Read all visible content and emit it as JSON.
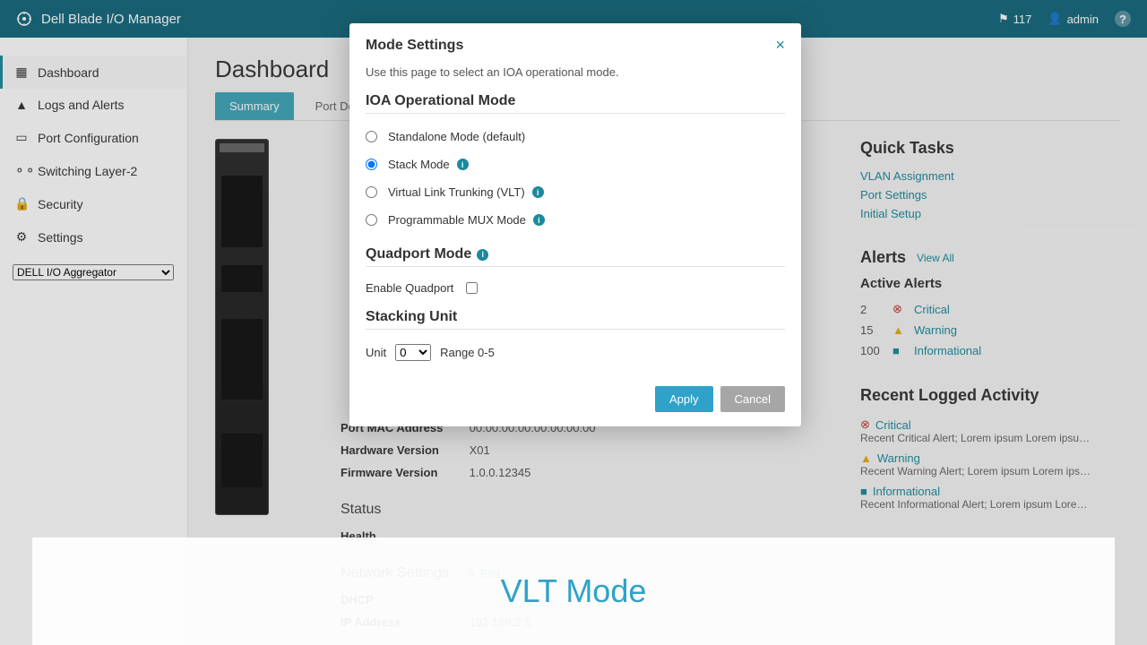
{
  "app": {
    "title": "Dell Blade I/O Manager"
  },
  "header": {
    "flag_count": "117",
    "user": "admin"
  },
  "sidebar": {
    "items": [
      {
        "label": "Dashboard"
      },
      {
        "label": "Logs and Alerts"
      },
      {
        "label": "Port Configuration"
      },
      {
        "label": "Switching Layer-2"
      },
      {
        "label": "Security"
      },
      {
        "label": "Settings"
      }
    ],
    "device_selected": "DELL I/O Aggregator"
  },
  "page": {
    "title": "Dashboard",
    "tabs": [
      {
        "label": "Summary"
      },
      {
        "label": "Port Details"
      }
    ]
  },
  "info": {
    "port_mac_label": "Port MAC Address",
    "port_mac_value": "00:00:00:00:00:00:00:00",
    "hw_label": "Hardware Version",
    "hw_value": "X01",
    "fw_label": "Firmware Version",
    "fw_value": "1.0.0.12345",
    "status_h": "Status",
    "health_label": "Health",
    "net_h": "Network Settings",
    "net_edit": "Edit",
    "dhcp_label": "DHCP",
    "dhcp_value": " ",
    "ip_label": "IP Address",
    "ip_value": "192.168.2.1"
  },
  "quicktasks": {
    "title": "Quick Tasks",
    "links": [
      "VLAN Assignment",
      "Port Settings",
      "Initial Setup"
    ]
  },
  "alerts": {
    "title": "Alerts",
    "viewall": "View All",
    "active_title": "Active Alerts",
    "rows": [
      {
        "count": "2",
        "label": "Critical"
      },
      {
        "count": "15",
        "label": "Warning"
      },
      {
        "count": "100",
        "label": "Informational"
      }
    ]
  },
  "recent": {
    "title": "Recent Logged Activity",
    "items": [
      {
        "label": "Critical",
        "desc": "Recent Critical Alert; Lorem ipsum Lorem ipsu…"
      },
      {
        "label": "Warning",
        "desc": "Recent Warning Alert; Lorem ipsum Lorem ips…"
      },
      {
        "label": "Informational",
        "desc": "Recent Informational Alert; Lorem ipsum Lore…"
      }
    ]
  },
  "modal": {
    "title": "Mode Settings",
    "desc": "Use this page to select an IOA operational mode.",
    "ioa_h": "IOA Operational Mode",
    "opts": [
      "Standalone Mode (default)",
      "Stack Mode",
      "Virtual Link Trunking (VLT)",
      "Programmable MUX Mode"
    ],
    "qp_h": "Quadport Mode",
    "qp_label": "Enable Quadport",
    "su_h": "Stacking Unit",
    "su_label": "Unit",
    "su_value": "0",
    "su_range": "Range 0-5",
    "apply": "Apply",
    "cancel": "Cancel"
  },
  "banner": "VLT Mode"
}
